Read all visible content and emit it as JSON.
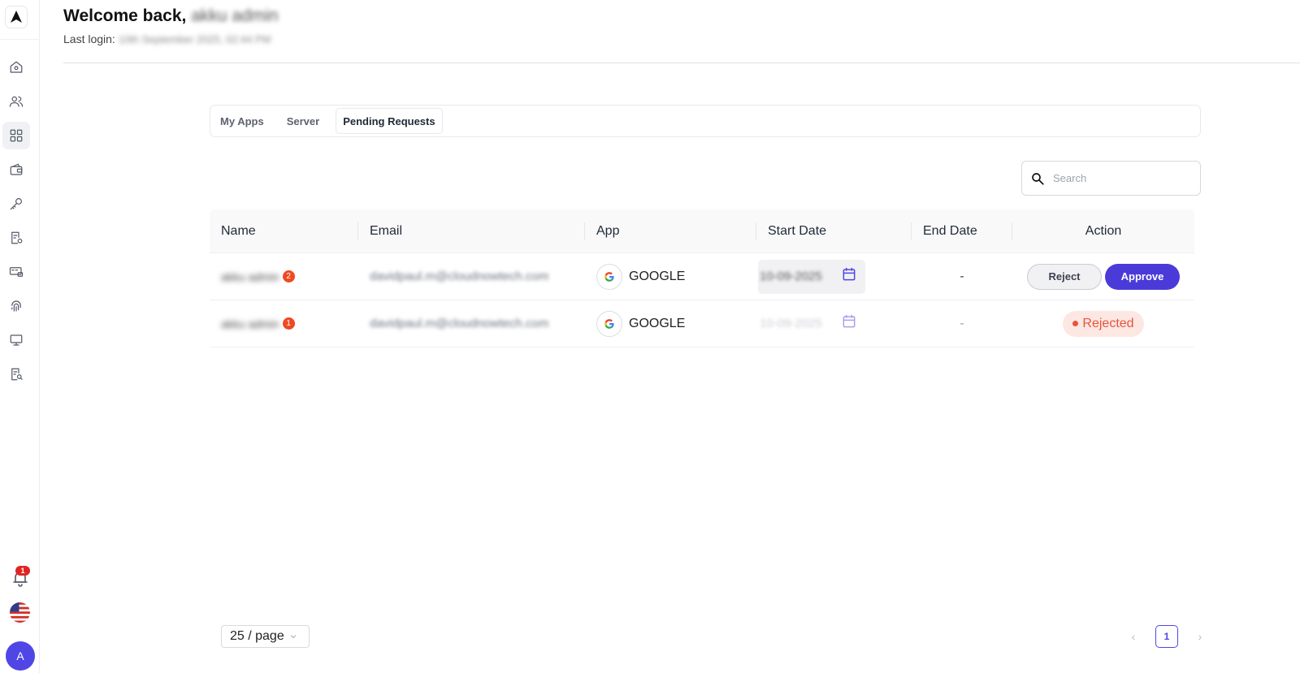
{
  "header": {
    "welcome_prefix": "Welcome back,",
    "user_name": "akku admin",
    "last_login_label": "Last login:",
    "last_login_value": "10th September 2025, 02:44 PM"
  },
  "tabs": [
    {
      "label": "My Apps",
      "active": false
    },
    {
      "label": "Server",
      "active": false
    },
    {
      "label": "Pending Requests",
      "active": true
    }
  ],
  "search": {
    "placeholder": "Search"
  },
  "table": {
    "columns": [
      "Name",
      "Email",
      "App",
      "Start Date",
      "End Date",
      "Action"
    ],
    "rows": [
      {
        "name": "akku admin",
        "count": "2",
        "email": "davidpaul.m@cloudnowtech.com",
        "app": "GOOGLE",
        "start_date": "10-09-2025",
        "end_date": "-",
        "reject_label": "Reject",
        "approve_label": "Approve"
      },
      {
        "name": "akku admin",
        "count": "1",
        "email": "davidpaul.m@cloudnowtech.com",
        "app": "GOOGLE",
        "start_date": "10-09-2025",
        "end_date": "-",
        "status": "Rejected"
      }
    ]
  },
  "pagination": {
    "page_size": "25 / page",
    "current_page": "1",
    "prev": "‹",
    "next": "›"
  },
  "sidebar": {
    "notification_count": "1",
    "avatar_letter": "A"
  },
  "colors": {
    "primary": "#4a3bd9",
    "danger": "#e8543a",
    "badge": "#ef4923"
  }
}
